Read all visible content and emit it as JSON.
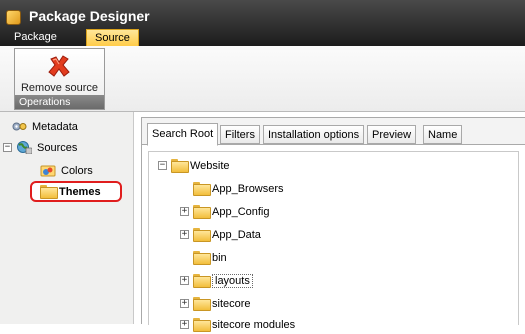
{
  "app": {
    "title": "Package Designer",
    "accent": "#ffcc4a"
  },
  "ribbon_tabs": [
    {
      "label": "Package",
      "active": false
    },
    {
      "label": "Source",
      "active": true
    }
  ],
  "ribbon": {
    "remove_source_label": "Remove source",
    "group_label": "Operations",
    "remove_icon": "red-x-icon"
  },
  "left_tree": {
    "metadata": {
      "label": "Metadata",
      "icon": "metadata-icon"
    },
    "sources": {
      "label": "Sources",
      "icon": "sources-icon",
      "expanded": true
    },
    "colors": {
      "label": "Colors",
      "icon": "colors-icon"
    },
    "themes": {
      "label": "Themes",
      "icon": "folder-icon",
      "highlight_color": "#e01d1d"
    }
  },
  "tabs": [
    {
      "label": "Search Root",
      "active": true
    },
    {
      "label": "Filters",
      "active": false
    },
    {
      "label": "Installation options",
      "active": false
    },
    {
      "label": "Preview",
      "active": false
    },
    {
      "label": "Name",
      "active": false
    }
  ],
  "content_tree": {
    "root": "Website",
    "children": [
      {
        "label": "App_Browsers",
        "expander": false,
        "selected": false
      },
      {
        "label": "App_Config",
        "expander": true,
        "selected": false
      },
      {
        "label": "App_Data",
        "expander": true,
        "selected": false
      },
      {
        "label": "bin",
        "expander": false,
        "selected": false
      },
      {
        "label": "layouts",
        "expander": true,
        "selected": true
      },
      {
        "label": "sitecore",
        "expander": true,
        "selected": false
      },
      {
        "label": "sitecore modules",
        "expander": true,
        "selected": false
      }
    ]
  }
}
